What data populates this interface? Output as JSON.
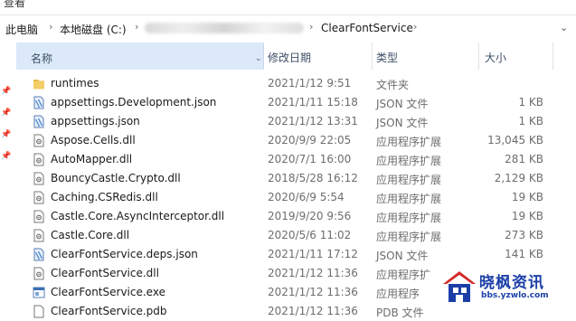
{
  "menu": {
    "label": "查看"
  },
  "address": {
    "crumbs": [
      "此电脑",
      "本地磁盘 (C:)",
      "ClearFontService"
    ],
    "expand_icon": "chevron-down-icon"
  },
  "columns": {
    "name": "名称",
    "date": "修改日期",
    "type": "类型",
    "size": "大小"
  },
  "files": [
    {
      "name": "runtimes",
      "date": "2021/1/12 9:51",
      "type": "文件夹",
      "size": "",
      "icon": "folder-icon"
    },
    {
      "name": "appsettings.Development.json",
      "date": "2021/1/11 15:18",
      "type": "JSON 文件",
      "size": "1 KB",
      "icon": "json-file-icon"
    },
    {
      "name": "appsettings.json",
      "date": "2021/1/12 13:31",
      "type": "JSON 文件",
      "size": "1 KB",
      "icon": "json-file-icon"
    },
    {
      "name": "Aspose.Cells.dll",
      "date": "2020/9/9 22:05",
      "type": "应用程序扩展",
      "size": "13,045 KB",
      "icon": "dll-file-icon"
    },
    {
      "name": "AutoMapper.dll",
      "date": "2020/7/1 16:00",
      "type": "应用程序扩展",
      "size": "281 KB",
      "icon": "dll-file-icon"
    },
    {
      "name": "BouncyCastle.Crypto.dll",
      "date": "2018/5/28 16:12",
      "type": "应用程序扩展",
      "size": "2,129 KB",
      "icon": "dll-file-icon"
    },
    {
      "name": "Caching.CSRedis.dll",
      "date": "2020/6/9 5:54",
      "type": "应用程序扩展",
      "size": "19 KB",
      "icon": "dll-file-icon"
    },
    {
      "name": "Castle.Core.AsyncInterceptor.dll",
      "date": "2019/9/20 9:56",
      "type": "应用程序扩展",
      "size": "19 KB",
      "icon": "dll-file-icon"
    },
    {
      "name": "Castle.Core.dll",
      "date": "2020/5/6 11:02",
      "type": "应用程序扩展",
      "size": "273 KB",
      "icon": "dll-file-icon"
    },
    {
      "name": "ClearFontService.deps.json",
      "date": "2021/1/11 17:12",
      "type": "JSON 文件",
      "size": "141 KB",
      "icon": "json-file-icon"
    },
    {
      "name": "ClearFontService.dll",
      "date": "2021/1/12 11:36",
      "type": "应用程序扩",
      "size": "",
      "icon": "dll-file-icon"
    },
    {
      "name": "ClearFontService.exe",
      "date": "2021/1/12 11:36",
      "type": "应用程序",
      "size": "",
      "icon": "exe-file-icon"
    },
    {
      "name": "ClearFontService.pdb",
      "date": "2021/1/12 11:36",
      "type": "PDB 文件",
      "size": "",
      "icon": "pdb-file-icon"
    }
  ],
  "watermark": {
    "title": "晓枫资讯",
    "url": "bbs.yzwlo.com"
  },
  "colors": {
    "header_selected": "#dbe9f8",
    "folder": "#e8b94a",
    "watermark_blue": "#1c3fa7",
    "watermark_red": "#d42a2a"
  }
}
